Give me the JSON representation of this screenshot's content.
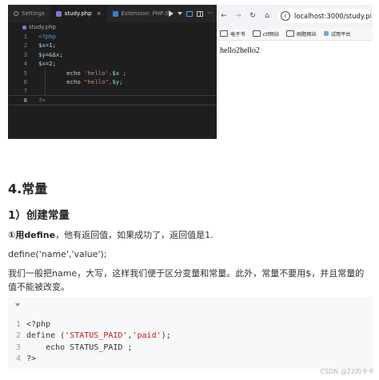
{
  "editor": {
    "tabs": [
      {
        "label": "Settings",
        "icon": "gear-icon"
      },
      {
        "label": "study.php",
        "icon": "php-file-icon",
        "close": "×"
      },
      {
        "label": "Extension: PHP Se",
        "icon": "extension-icon"
      }
    ],
    "breadcrumb": "study.php",
    "lines": [
      {
        "n": "1",
        "parts": [
          {
            "t": "<?php",
            "c": "c-tag"
          }
        ]
      },
      {
        "n": "2",
        "parts": [
          {
            "t": "$x",
            "c": "c-var"
          },
          {
            "t": "=1;",
            "c": "c-plain"
          }
        ]
      },
      {
        "n": "3",
        "parts": [
          {
            "t": "$y",
            "c": "c-var"
          },
          {
            "t": "=&",
            "c": "c-plain"
          },
          {
            "t": "$x",
            "c": "c-var"
          },
          {
            "t": ";",
            "c": "c-plain"
          }
        ]
      },
      {
        "n": "4",
        "parts": [
          {
            "t": "$x",
            "c": "c-var"
          },
          {
            "t": "=2;",
            "c": "c-plain"
          }
        ]
      },
      {
        "n": "5",
        "parts": [
          {
            "t": "        ",
            "c": "c-plain"
          },
          {
            "t": "echo",
            "c": "c-kw"
          },
          {
            "t": " ",
            "c": "c-plain"
          },
          {
            "t": "'hello'",
            "c": "c-str"
          },
          {
            "t": ".",
            "c": "c-plain"
          },
          {
            "t": "$x",
            "c": "c-var"
          },
          {
            "t": " ;",
            "c": "c-plain"
          }
        ]
      },
      {
        "n": "6",
        "parts": [
          {
            "t": "        ",
            "c": "c-plain"
          },
          {
            "t": "echo",
            "c": "c-kw"
          },
          {
            "t": " ",
            "c": "c-plain"
          },
          {
            "t": "\"hello\"",
            "c": "c-str"
          },
          {
            "t": ".",
            "c": "c-plain"
          },
          {
            "t": "$y",
            "c": "c-var"
          },
          {
            "t": ";",
            "c": "c-plain"
          }
        ]
      },
      {
        "n": "7",
        "parts": []
      },
      {
        "n": "8",
        "parts": [
          {
            "t": "?>",
            "c": "c-tag"
          }
        ],
        "current": true
      }
    ]
  },
  "browser": {
    "nav": {
      "back": "←",
      "forward": "→",
      "reload": "↻",
      "home": "⌂"
    },
    "url": "localhost:3000/study.php",
    "bookmarks": [
      {
        "label": "电子书",
        "icon": "folder-icon"
      },
      {
        "label": "ctf网站",
        "icon": "folder-icon"
      },
      {
        "label": "刷题网站",
        "icon": "folder-icon"
      },
      {
        "label": "试用平台",
        "icon": "bookmark-icon"
      }
    ],
    "output": "hello2hello2"
  },
  "article": {
    "heading": "4.常量",
    "subheading": "1）创建常量",
    "p1_bold": "①用define",
    "p1_rest": "，他有返回值，如果成功了，返回值是1.",
    "p2": "define('name','value');",
    "p3": "我们一般把name，大写，这样我们便于区分变量和常量。此外，常量不要用$，并且常量的值不能被改变。",
    "code": [
      {
        "n": "1",
        "parts": [
          {
            "t": "<?php",
            "c": "k-tag"
          }
        ]
      },
      {
        "n": "2",
        "parts": [
          {
            "t": "define",
            "c": "k-kw"
          },
          {
            "t": " (",
            "c": "k-kw"
          },
          {
            "t": "'STATUS_PAID'",
            "c": "k-str"
          },
          {
            "t": ",",
            "c": "k-kw"
          },
          {
            "t": "'paid'",
            "c": "k-str"
          },
          {
            "t": ");",
            "c": "k-kw"
          }
        ]
      },
      {
        "n": "3",
        "parts": [
          {
            "t": "    echo STATUS_PAID ;",
            "c": "k-kw"
          }
        ]
      },
      {
        "n": "4",
        "parts": [
          {
            "t": "?>",
            "c": "k-tag"
          }
        ]
      }
    ]
  },
  "footer": "CSDN @22的卡卡"
}
